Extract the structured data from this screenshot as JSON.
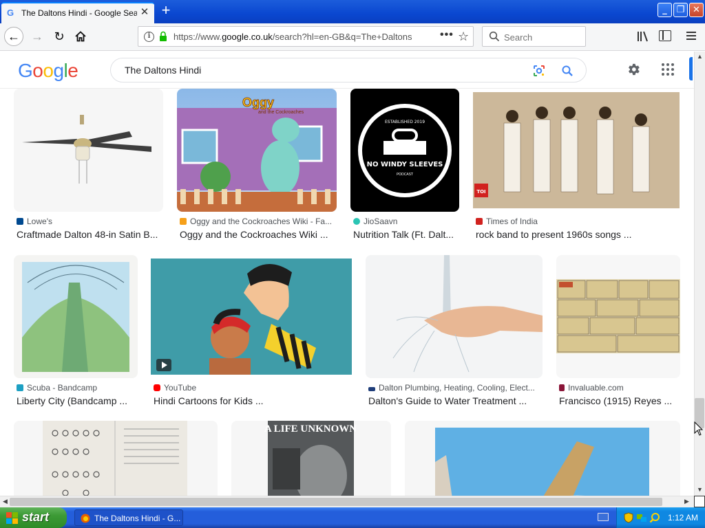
{
  "browser": {
    "tab_title": "The Daltons Hindi - Google Search",
    "url_prefix": "https://www.",
    "url_domain": "google.co.uk",
    "url_rest": "/search?hl=en-GB&q=The+Daltons",
    "search_placeholder": "Search"
  },
  "google": {
    "logo_letters": [
      "G",
      "o",
      "o",
      "g",
      "l",
      "e"
    ],
    "logo_colors": [
      "#4285f4",
      "#ea4335",
      "#fbbc05",
      "#4285f4",
      "#34a853",
      "#ea4335"
    ],
    "query": "The Daltons Hindi"
  },
  "results": [
    {
      "source": "Lowe's",
      "title": "Craftmade Dalton 48-in Satin B...",
      "icon_color": "#004990"
    },
    {
      "source": "Oggy and the Cockroaches Wiki - Fa...",
      "title": "Oggy and the Cockroaches Wiki ...",
      "icon_color": "#f6a019"
    },
    {
      "source": "JioSaavn",
      "title": "Nutrition Talk (Ft. Dalt...",
      "icon_color": "#2bc5b4"
    },
    {
      "source": "Times of India",
      "title": "rock band to present 1960s songs ...",
      "icon_color": "#d1221f"
    },
    {
      "source": "Scuba - Bandcamp",
      "title": "Liberty City (Bandcamp ...",
      "icon_color": "#1da0c3"
    },
    {
      "source": "YouTube",
      "title": "Hindi Cartoons for Kids ...",
      "icon_color": "#ff0000"
    },
    {
      "source": "Dalton Plumbing, Heating, Cooling, Elect...",
      "title": "Dalton's Guide to Water Treatment ...",
      "icon_color": "#1f3d7a"
    },
    {
      "source": "Invaluable.com",
      "title": "Francisco (1915) Reyes ...",
      "icon_color": "#8a1538"
    }
  ],
  "thumb_texts": {
    "oggy_logo": "Oggy",
    "oggy_logo_sub": "and the Cockroaches",
    "podcast_top": "ESTABLISHED 2019",
    "podcast_name": "NO WINDY SLEEVES",
    "podcast_sub": "PODCAST",
    "toi_badge": "TOI",
    "poster_title": "A LIFE UNKNOWN"
  },
  "taskbar": {
    "start_label": "start",
    "task_label": "The Daltons Hindi - G...",
    "clock": "1:12 AM"
  }
}
